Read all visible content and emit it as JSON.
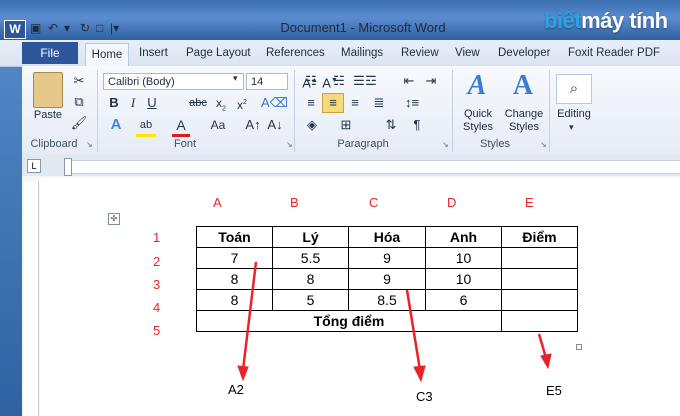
{
  "window": {
    "title": "Document1 - Microsoft Word",
    "app_icon": "W"
  },
  "brand": {
    "part1": "biết",
    "part2": "máy tính"
  },
  "tabs": {
    "file": "File",
    "home": "Home",
    "insert": "Insert",
    "page_layout": "Page Layout",
    "references": "References",
    "mailings": "Mailings",
    "review": "Review",
    "view": "View",
    "developer": "Developer",
    "foxit": "Foxit Reader PDF"
  },
  "clipboard": {
    "paste": "Paste",
    "label": "Clipboard"
  },
  "font": {
    "name": "Calibri (Body)",
    "size": "14",
    "label": "Font"
  },
  "paragraph": {
    "label": "Paragraph"
  },
  "styles": {
    "quick": "Quick",
    "quick2": "Styles",
    "change": "Change",
    "change2": "Styles",
    "label": "Styles"
  },
  "editing": {
    "label": "Editing"
  },
  "columns": [
    "A",
    "B",
    "C",
    "D",
    "E"
  ],
  "rows": [
    "1",
    "2",
    "3",
    "4",
    "5"
  ],
  "table": {
    "header": [
      "Toán",
      "Lý",
      "Hóa",
      "Anh",
      "Điểm"
    ],
    "r2": [
      "7",
      "5.5",
      "9",
      "10",
      ""
    ],
    "r3": [
      "8",
      "8",
      "9",
      "10",
      ""
    ],
    "r4": [
      "8",
      "5",
      "8.5",
      "6",
      ""
    ],
    "total": "Tổng điểm"
  },
  "annotations": [
    "A2",
    "C3",
    "E5"
  ],
  "colors": {
    "accent": "#2b579a",
    "annotation": "#e8242a"
  }
}
